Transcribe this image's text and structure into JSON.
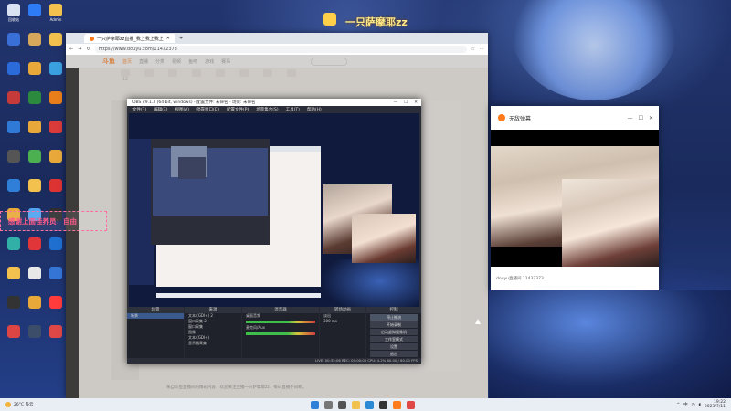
{
  "desktop": {
    "banner_text": "一只萨摩耶zz",
    "icons": [
      {
        "label": "回收站",
        "color": "#d9e2f2"
      },
      {
        "label": "",
        "color": "#2d7cf6"
      },
      {
        "label": "Admin",
        "color": "#f2c14e"
      },
      {
        "label": "",
        "color": "#3b6fd8"
      },
      {
        "label": "",
        "color": "#d6a85c"
      },
      {
        "label": "",
        "color": "#f2c14e"
      },
      {
        "label": "",
        "color": "#2b6ad9"
      },
      {
        "label": "",
        "color": "#e8a93a"
      },
      {
        "label": "",
        "color": "#3aa0e0"
      },
      {
        "label": "",
        "color": "#c63a3a"
      },
      {
        "label": "",
        "color": "#2c8a3f"
      },
      {
        "label": "",
        "color": "#e87e1a"
      },
      {
        "label": "",
        "color": "#2e7ad6"
      },
      {
        "label": "",
        "color": "#e8a93a"
      },
      {
        "label": "",
        "color": "#d93a3a"
      },
      {
        "label": "",
        "color": "#555555"
      },
      {
        "label": "",
        "color": "#4caf50"
      },
      {
        "label": "",
        "color": "#e8a93a"
      },
      {
        "label": "",
        "color": "#2f7fd8"
      },
      {
        "label": "",
        "color": "#f2c14e"
      },
      {
        "label": "",
        "color": "#dd3333"
      },
      {
        "label": "",
        "color": "#e8a93a"
      },
      {
        "label": "",
        "color": "#4fa3ef"
      },
      {
        "label": "",
        "color": "#2e2e2e"
      },
      {
        "label": "",
        "color": "#31b0a8"
      },
      {
        "label": "",
        "color": "#e0363a"
      },
      {
        "label": "",
        "color": "#1f6fd1"
      },
      {
        "label": "",
        "color": "#f2c14e"
      },
      {
        "label": "",
        "color": "#e8e8e8"
      },
      {
        "label": "",
        "color": "#3575d6"
      },
      {
        "label": "",
        "color": "#333333"
      },
      {
        "label": "",
        "color": "#e8a93a"
      },
      {
        "label": "",
        "color": "#ff3b3b"
      },
      {
        "label": "",
        "color": "#d44"
      },
      {
        "label": "",
        "color": "#3b4d68"
      },
      {
        "label": "",
        "color": "#e04848"
      }
    ]
  },
  "browser": {
    "tab_title": "一只萨摩耶zz直播_我上我上我上",
    "url": "https://www.douyu.com/11432373",
    "site": {
      "logo": "斗鱼",
      "nav": [
        "首页",
        "直播",
        "分类",
        "视频",
        "鱼吧",
        "游戏",
        "赛事"
      ],
      "categories": [
        "12",
        "",
        "",
        "",
        "",
        "",
        "",
        ""
      ],
      "room_text": "来自斗鱼直播间的精彩内容，欢迎关注主播一只萨摩耶zz，每日直播不间断。"
    }
  },
  "obs": {
    "title": "OBS 29.1.3 (64-bit, windows) - 配置文件: 未命名 - 场景: 未命名",
    "menu": [
      "文件(F)",
      "编辑(E)",
      "视图(V)",
      "停靠窗口(D)",
      "配置文件(P)",
      "场景集合(S)",
      "工具(T)",
      "帮助(H)"
    ],
    "docks": {
      "scenes_header": "场景",
      "scenes": [
        "场景"
      ],
      "sources_header": "来源",
      "sources": [
        "文本 (GDI+) 2",
        "窗口采集 2",
        "窗口采集",
        "图像",
        "文本 (GDI+)",
        "显示器采集"
      ],
      "mixer_header": "混音器",
      "mixer_items": [
        "桌面音频",
        "麦克风/Aux"
      ],
      "transitions_header": "转场动画",
      "transition_value": "淡出",
      "transition_duration": "300 ms",
      "controls_header": "控制",
      "controls": [
        "停止推流",
        "开始录制",
        "启动虚拟摄像机",
        "工作室模式",
        "设置",
        "退出"
      ]
    },
    "status": "LIVE: 00:35:06  REC: 00:00:00  CPU: 4.2%  60.00 / 60.00 FPS"
  },
  "popup": {
    "title": "无敌弹幕",
    "footer_text": "douyu直播间 11432373",
    "controls": [
      "—",
      "☐",
      "✕"
    ]
  },
  "danmaku": {
    "text": "感谢上面佳养员：自由"
  },
  "taskbar": {
    "weather_temp": "26°C",
    "weather_desc": "多云",
    "time": "19:22",
    "date": "2023/7/11",
    "lang": "中"
  }
}
